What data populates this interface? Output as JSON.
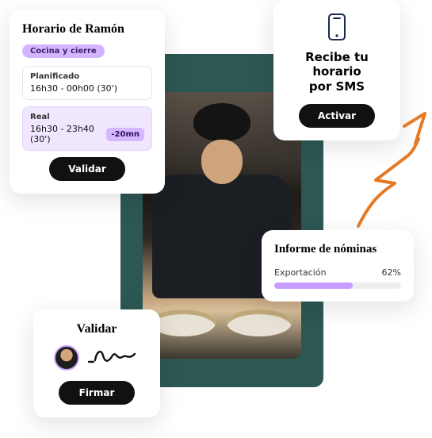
{
  "accent": "#c59eff",
  "schedule": {
    "title": "Horario de Ramón",
    "badge": "Cocina y cierre",
    "planned": {
      "label": "Planificado",
      "value": "16h30 - 00h00 (30')"
    },
    "real": {
      "label": "Real",
      "value": "16h30 - 23h40 (30')",
      "delta": "-20mn"
    },
    "validate_label": "Validar"
  },
  "sms": {
    "title_l1": "Recibe tu horario",
    "title_l2": "por SMS",
    "activate_label": "Activar",
    "icon": "phone-icon"
  },
  "sign": {
    "title": "Validar",
    "sign_label": "Firmar",
    "avatar": "avatar-ramon",
    "signature": "signature-scribble"
  },
  "payroll": {
    "title": "Informe de nóminas",
    "export_label": "Exportación",
    "percent_label": "62%",
    "percent_value": 62
  },
  "arrow": {
    "icon": "growth-arrow",
    "color": "#e57a26"
  }
}
